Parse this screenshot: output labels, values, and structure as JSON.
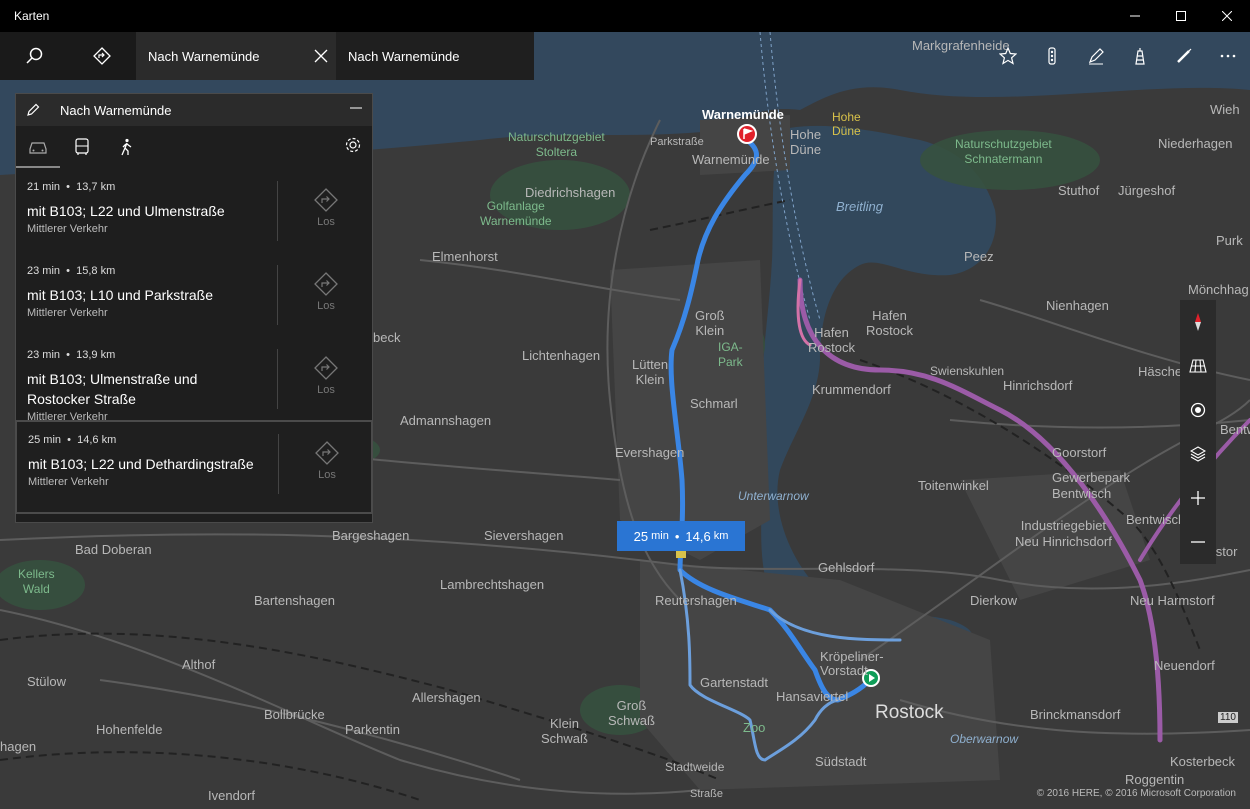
{
  "window": {
    "title": "Karten"
  },
  "tabs": [
    {
      "label": "Nach Warnemünde",
      "active": true
    },
    {
      "label": "Nach Warnemünde",
      "active": false
    }
  ],
  "panel": {
    "title": "Nach Warnemünde",
    "routes": [
      {
        "time": "21 min",
        "distance": "13,7 km",
        "name": "mit B103; L22 und Ulmenstraße",
        "traffic": "Mittlerer Verkehr",
        "go": "Los"
      },
      {
        "time": "23 min",
        "distance": "15,8 km",
        "name": "mit B103; L10 und Parkstraße",
        "traffic": "Mittlerer Verkehr",
        "go": "Los"
      },
      {
        "time": "23 min",
        "distance": "13,9 km",
        "name": "mit B103; Ulmenstraße und Rostocker Straße",
        "traffic": "Mittlerer Verkehr",
        "go": "Los"
      },
      {
        "time": "25 min",
        "distance": "14,6 km",
        "name": "mit B103; L22 und Dethardingstraße",
        "traffic": "Mittlerer Verkehr",
        "go": "Los",
        "selected": true
      }
    ]
  },
  "callout": {
    "time": "25",
    "time_unit": "min",
    "distance": "14,6",
    "distance_unit": "km"
  },
  "separator": "•",
  "copyright": "© 2016 HERE, © 2016 Microsoft Corporation",
  "map_labels": {
    "warnemuende": "Warnemünde",
    "warnemuende2": "Warnemünde",
    "hohe_duene": "Hohe Düne",
    "hohe_duene2": "Hohe\nDüne",
    "markgrafenheide": "Markgrafenheide",
    "wieh": "Wieh",
    "niederhagen": "Niederhagen",
    "ns_stoltera": "Naturschutzgebiet\nStoltera",
    "ns_schnatermann": "Naturschutzgebiet\nSchnatermann",
    "parkstrasse": "Parkstraße",
    "diedrichshagen": "Diedrichshagen",
    "golfanlage": "Golfanlage\nWarnemünde",
    "breitling": "Breitling",
    "stuthof": "Stuthof",
    "juergeshof": "Jürgeshof",
    "purk": "Purk",
    "elmenhorst": "Elmenhorst",
    "peez": "Peez",
    "moenchhag": "Mönchhag",
    "nienhagen": "Nienhagen",
    "gross_klein": "Groß\nKlein",
    "hafen_rostock": "Hafen\nRostock",
    "hafen_rostock2": "Hafen\nRostock",
    "ga_park": "IGA-\nPark",
    "swienskuhlen": "Swienskuhlen",
    "haeschendorf": "Häschendorf",
    "hinrichsdorf": "Hinrichsdorf",
    "beck": "beck",
    "lichtenhagen": "Lichtenhagen",
    "luetten_klein": "Lütten\nKlein",
    "schmarl": "Schmarl",
    "krummendorf": "Krummendorf",
    "admannshagen": "Admannshagen",
    "evershagen": "Evershagen",
    "goorstorf": "Goorstorf",
    "gewerbepark": "Gewerbepark\nBentwisch",
    "bentwis": "Bentwis",
    "unterwarnow": "Unterwarnow",
    "toitenwinkel": "Toitenwinkel",
    "industriegebiet": "Industriegebiet\nNeu Hinrichsdorf",
    "bentwisch": "Bentwisch",
    "bad_doberan": "Bad Doberan",
    "bargeshagen": "Bargeshagen",
    "sievershagen": "Sievershagen",
    "harmstor": "Harmstor",
    "kellers_wald": "Kellers\nWald",
    "lambrechtshagen": "Lambrechtshagen",
    "gehlsdorf": "Gehlsdorf",
    "bartenshagen": "Bartenshagen",
    "reutershagen": "Reutershagen",
    "dierkow": "Dierkow",
    "neu_harmstorf": "Neu Harmstorf",
    "althof": "Althof",
    "kroepeliner": "Kröpeliner-\nVorstadt",
    "neuendorf": "Neuendorf",
    "stuelow": "Stülow",
    "gartenstadt": "Gartenstadt",
    "allershagen": "Allershagen",
    "hansaviertel": "Hansaviertel",
    "rostock": "Rostock",
    "bollbruecke": "Bollbrücke",
    "gross_schwass": "Groß\nSchwaß",
    "brinckmansdorf": "Brinckmansdorf",
    "hohenfelde": "Hohenfelde",
    "klein_schwass": "Klein\nSchwaß",
    "zoo": "Zoo",
    "parkentin": "Parkentin",
    "oberwarnow": "Oberwarnow",
    "hagen": "hagen",
    "suedstadt": "Südstadt",
    "kosterbeck": "Kosterbeck",
    "stadtweide": "Stadtweide",
    "ivendorf": "Ivendorf",
    "strasse": "Straße",
    "roggentin": "Roggentin",
    "road_110": "110"
  }
}
